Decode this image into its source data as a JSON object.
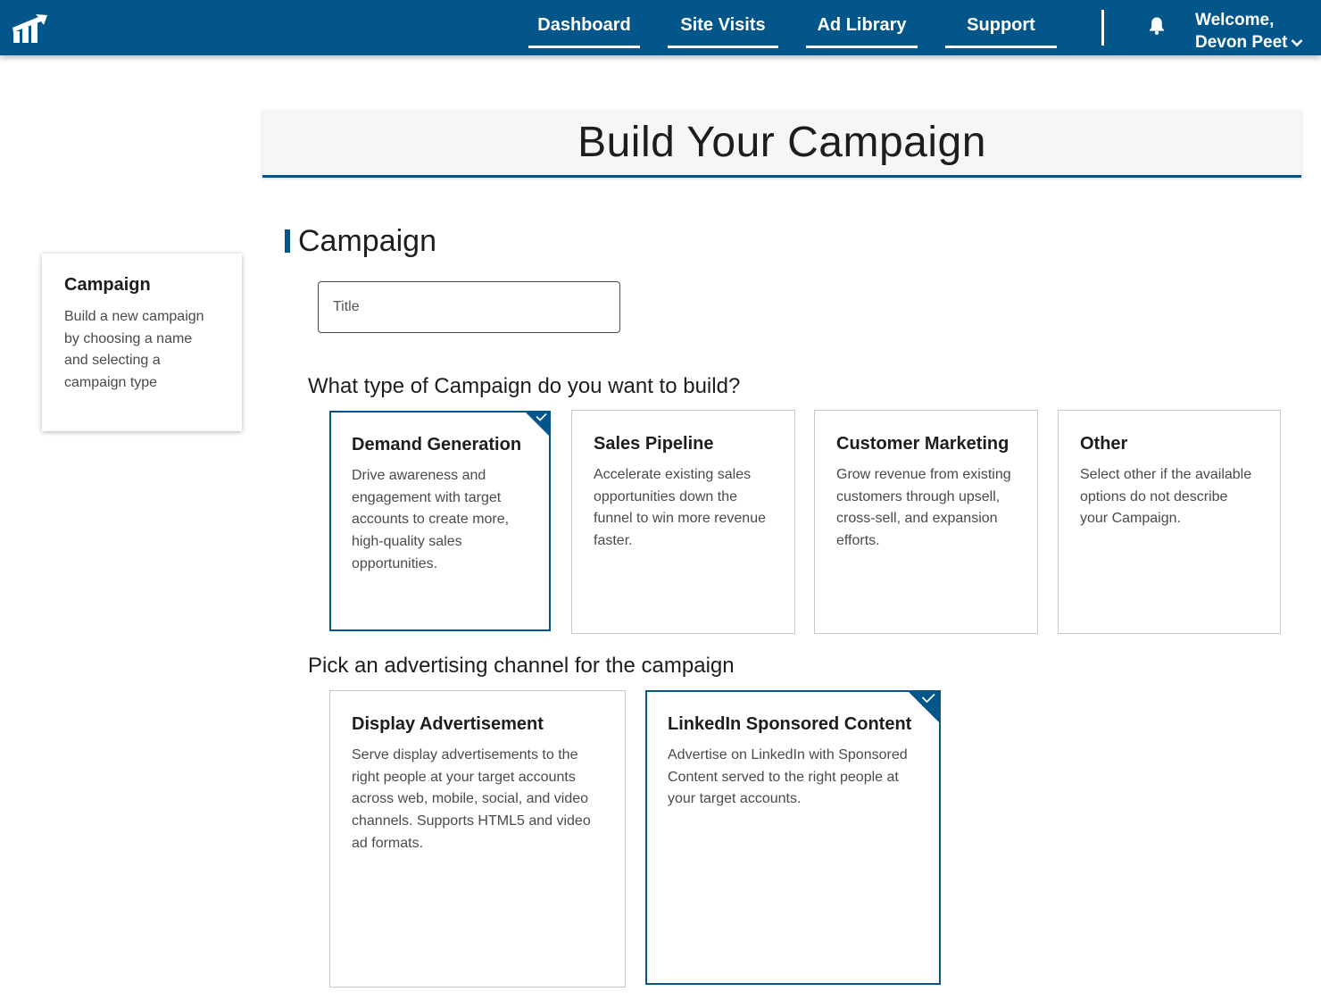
{
  "nav": {
    "items": [
      {
        "label": "Dashboard"
      },
      {
        "label": "Site Visits"
      },
      {
        "label": "Ad Library"
      },
      {
        "label": "Support"
      }
    ],
    "welcome_line1": "Welcome,",
    "welcome_line2": "Devon Peet",
    "icons": {
      "logo": "bar-chart-logo-icon",
      "notifications": "bell-icon",
      "dropdown": "chevron-down-icon"
    }
  },
  "page": {
    "title": "Build Your Campaign"
  },
  "step": {
    "title": "Campaign",
    "description": "Build a new campaign by choosing a name and selecting a campaign type"
  },
  "section": {
    "title": "Campaign"
  },
  "title_field": {
    "placeholder": "Title",
    "value": ""
  },
  "campaign_type": {
    "question": "What type of Campaign do you want to build?",
    "options": [
      {
        "title": "Demand Generation",
        "description": "Drive awareness and engagement with target accounts to create more, high-quality sales opportunities.",
        "selected": true
      },
      {
        "title": "Sales Pipeline",
        "description": "Accelerate existing sales opportunities down the funnel to win more revenue faster.",
        "selected": false
      },
      {
        "title": "Customer Marketing",
        "description": "Grow revenue from existing customers through upsell, cross-sell, and expansion efforts.",
        "selected": false
      },
      {
        "title": "Other",
        "description": "Select other if the available options do not describe your Campaign.",
        "selected": false
      }
    ]
  },
  "channel": {
    "question": "Pick an advertising channel for the campaign",
    "options": [
      {
        "title": "Display Advertisement",
        "description": "Serve display advertisements to the right people at your target accounts across web, mobile, social, and video channels. Supports HTML5 and video ad formats.",
        "selected": false
      },
      {
        "title": "LinkedIn Sponsored Content",
        "description": "Advertise on LinkedIn with Sponsored Content served to the right people at your target accounts.",
        "selected": true
      }
    ]
  },
  "colors": {
    "brand": "#02568a",
    "card_border": "#c8c8c8",
    "text": "#1d1d1d",
    "muted_text": "#4a4a4a"
  }
}
